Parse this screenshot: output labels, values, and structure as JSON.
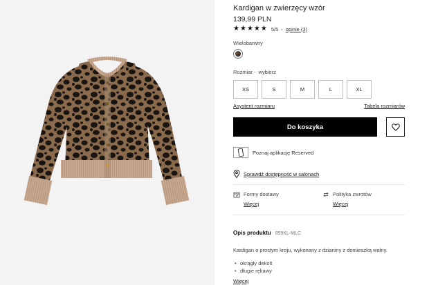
{
  "product": {
    "title": "Kardigan w zwierzęcy wzór",
    "price": "139,99 PLN",
    "rating_value": "5/5",
    "rating_separator": "-",
    "reviews_link": "opinie (3)",
    "stars_filled": 5,
    "stars_total": 5
  },
  "color": {
    "label": "Wielobarwny",
    "swatch_name": "leopard-print"
  },
  "size": {
    "label": "Rozmiar -",
    "choose": "wybierz",
    "options": [
      "XS",
      "S",
      "M",
      "L",
      "XL"
    ],
    "assistant_link": "Asystent rozmiaru",
    "table_link": "Tabela rozmiarów"
  },
  "actions": {
    "add_to_cart": "Do koszyka",
    "wishlist_icon": "heart-icon"
  },
  "app_promo": {
    "text": "Poznaj aplikację Reserved"
  },
  "store": {
    "link": "Sprawdź dostępność w salonach"
  },
  "shipping": {
    "delivery_label": "Formy dostawy",
    "delivery_more": "Więcej",
    "returns_label": "Polityka zwrotów",
    "returns_more": "Więcej"
  },
  "description": {
    "heading": "Opis produktu",
    "code": "959KL-MLC",
    "text": "Kardigan o prostym kroju, wykonany z dzianiny z domieszką wełny.",
    "bullets": [
      "okrągły dekolt",
      "długie rękawy"
    ],
    "more": "Więcej"
  },
  "colors": {
    "background_image": "#f3f3f3",
    "button_black": "#000000",
    "border_gray": "#bdbdbd"
  }
}
